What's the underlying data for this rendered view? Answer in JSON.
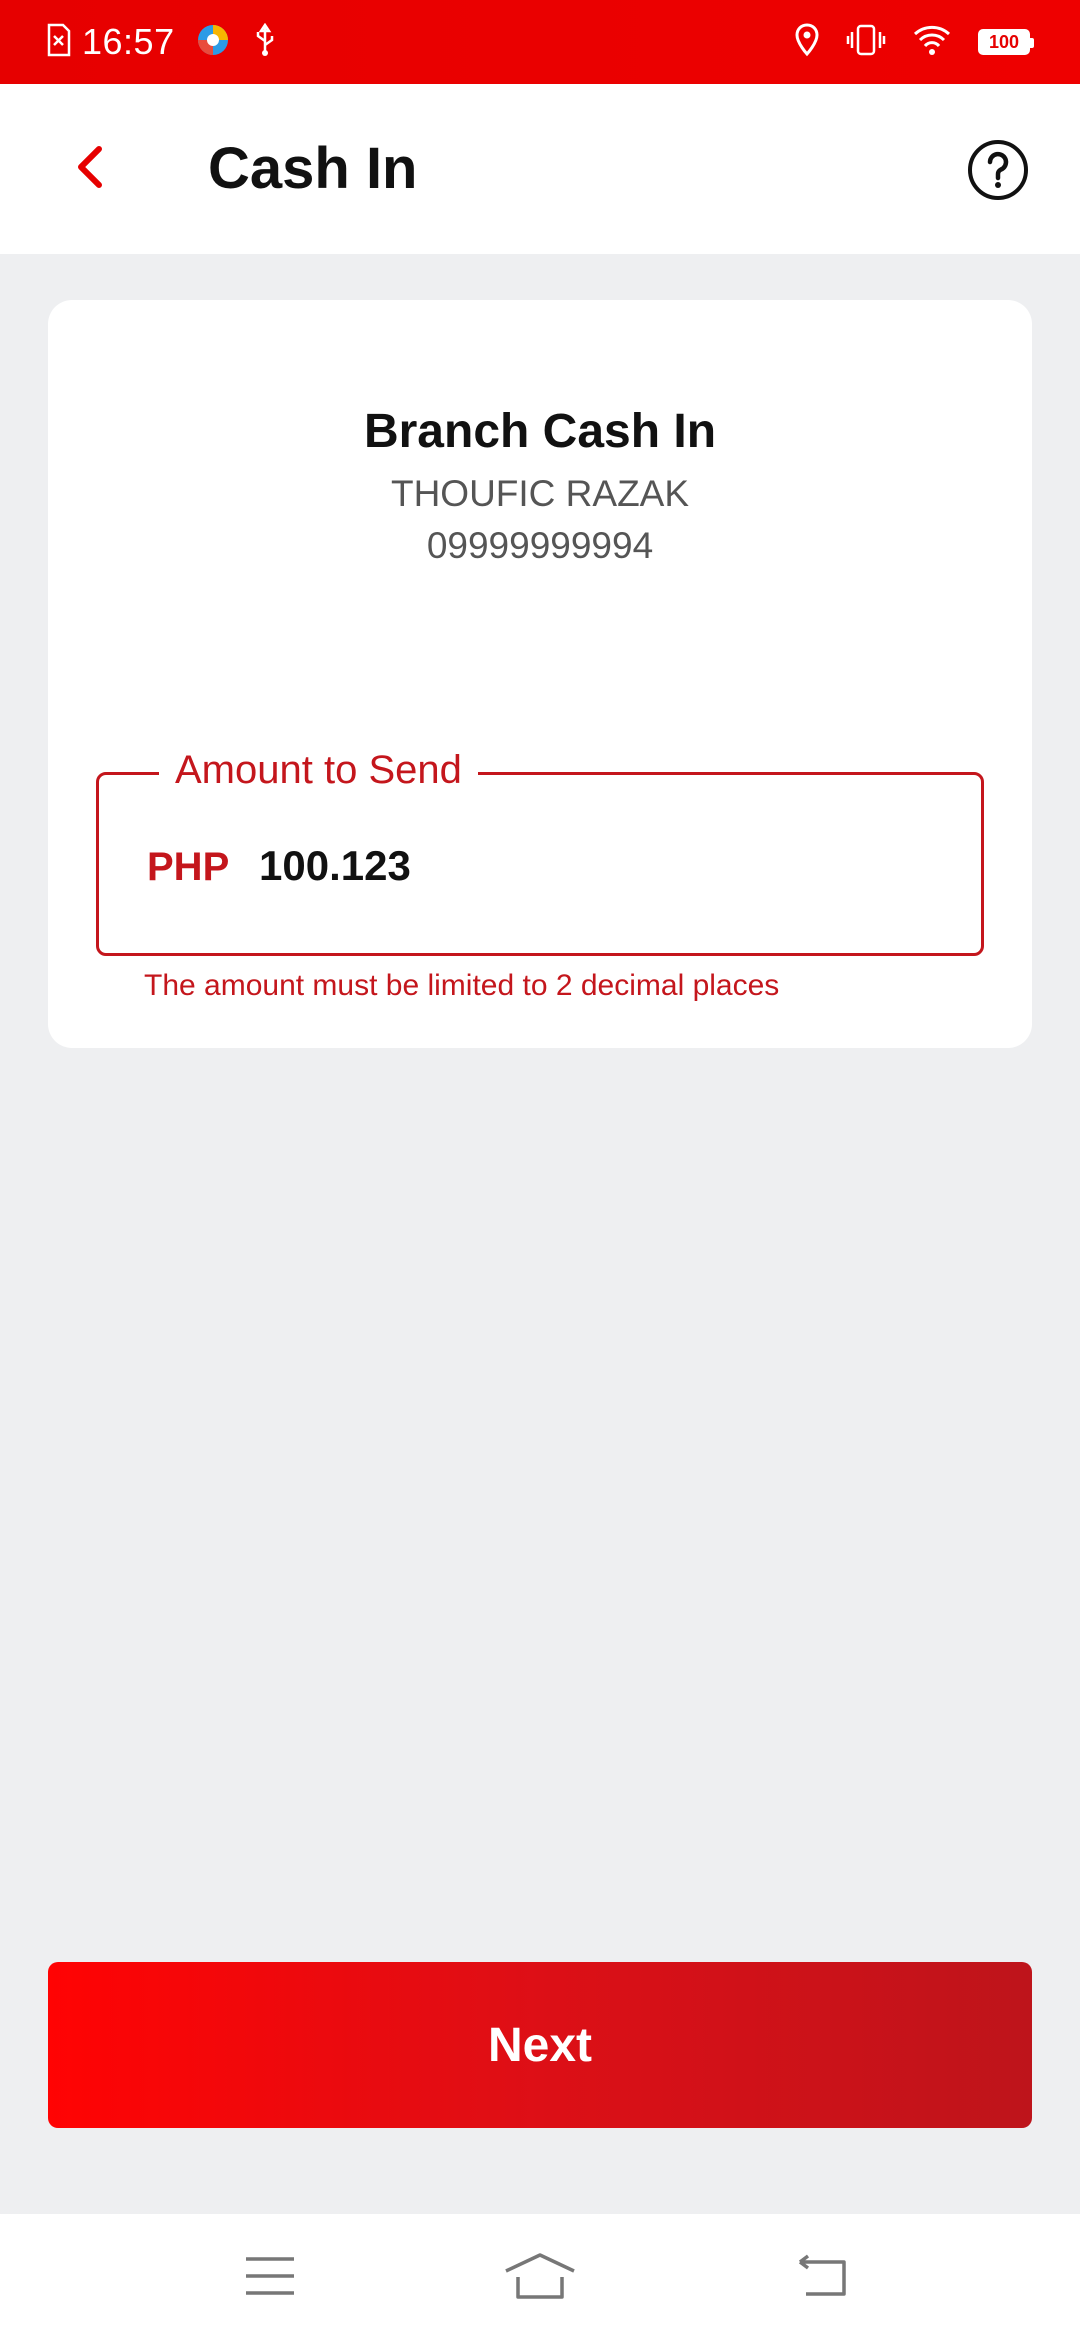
{
  "status_bar": {
    "time": "16:57",
    "battery": "100",
    "icons": [
      "sim-error-icon",
      "browser-app-icon",
      "usb-icon",
      "location-icon",
      "vibrate-icon",
      "wifi-icon",
      "battery-icon"
    ]
  },
  "app_bar": {
    "title": "Cash In",
    "back_icon": "chevron-left-icon",
    "help_icon": "help-circle-icon"
  },
  "card": {
    "title": "Branch Cash In",
    "name": "THOUFIC RAZAK",
    "phone": "09999999994"
  },
  "amount": {
    "label": "Amount to Send",
    "currency": "PHP",
    "value": "100.123",
    "error": "The amount must be limited to 2 decimal places"
  },
  "next_button": {
    "label": "Next"
  },
  "nav_bar": {
    "items": [
      "menu-icon",
      "home-icon",
      "back-icon"
    ]
  },
  "colors": {
    "accent": "#e60000",
    "error": "#c4161c",
    "background": "#eeeff1"
  }
}
